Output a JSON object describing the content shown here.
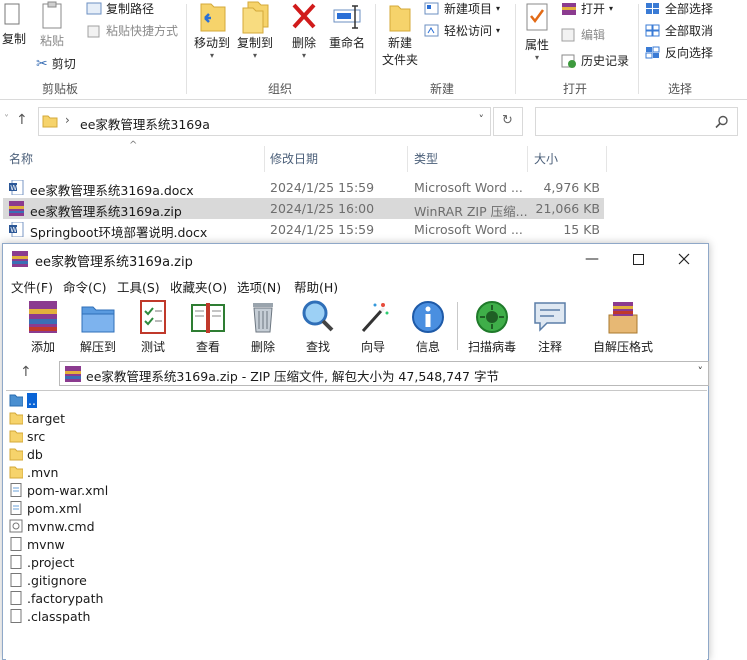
{
  "ribbon": {
    "clipboard": {
      "copy": "复制",
      "paste": "粘贴",
      "copy_path": "复制路径",
      "paste_shortcut": "粘贴快捷方式",
      "cut": "剪切",
      "group": "剪贴板"
    },
    "organize": {
      "move_to": "移动到",
      "copy_to": "复制到",
      "delete": "删除",
      "rename": "重命名",
      "group": "组织"
    },
    "new": {
      "new_folder_line1": "新建",
      "new_folder_line2": "文件夹",
      "new_item": "新建项目",
      "easy_access": "轻松访问",
      "group": "新建"
    },
    "open": {
      "properties": "属性",
      "open": "打开",
      "edit": "编辑",
      "history": "历史记录",
      "group": "打开"
    },
    "select": {
      "select_all": "全部选择",
      "select_none": "全部取消",
      "invert": "反向选择",
      "group": "选择"
    }
  },
  "address": {
    "path": "ee家教管理系统3169a"
  },
  "filelist": {
    "columns": [
      "名称",
      "修改日期",
      "类型",
      "大小"
    ],
    "rows": [
      {
        "name": "ee家教管理系统3169a.docx",
        "date": "2024/1/25 15:59",
        "type": "Microsoft Word ...",
        "size": "4,976 KB",
        "icon": "word-icon"
      },
      {
        "name": "ee家教管理系统3169a.zip",
        "date": "2024/1/25 16:00",
        "type": "WinRAR ZIP 压缩...",
        "size": "21,066 KB",
        "icon": "winrar-icon"
      },
      {
        "name": "Springboot环境部署说明.docx",
        "date": "2024/1/25 15:59",
        "type": "Microsoft Word ...",
        "size": "15 KB",
        "icon": "word-icon"
      }
    ]
  },
  "winrar": {
    "title": "ee家教管理系统3169a.zip",
    "menu": [
      "文件(F)",
      "命令(C)",
      "工具(S)",
      "收藏夹(O)",
      "选项(N)",
      "帮助(H)"
    ],
    "toolbar": [
      "添加",
      "解压到",
      "测试",
      "查看",
      "删除",
      "查找",
      "向导",
      "信息",
      "扫描病毒",
      "注释",
      "自解压格式"
    ],
    "path": "ee家教管理系统3169a.zip - ZIP 压缩文件, 解包大小为 47,548,747 字节",
    "entries": [
      {
        "name": "..",
        "kind": "up"
      },
      {
        "name": "target",
        "kind": "folder"
      },
      {
        "name": "src",
        "kind": "folder"
      },
      {
        "name": "db",
        "kind": "folder"
      },
      {
        "name": ".mvn",
        "kind": "folder"
      },
      {
        "name": "pom-war.xml",
        "kind": "xml"
      },
      {
        "name": "pom.xml",
        "kind": "xml"
      },
      {
        "name": "mvnw.cmd",
        "kind": "cmd"
      },
      {
        "name": "mvnw",
        "kind": "file"
      },
      {
        "name": ".project",
        "kind": "file"
      },
      {
        "name": ".gitignore",
        "kind": "file"
      },
      {
        "name": ".factorypath",
        "kind": "file"
      },
      {
        "name": ".classpath",
        "kind": "file"
      }
    ]
  }
}
